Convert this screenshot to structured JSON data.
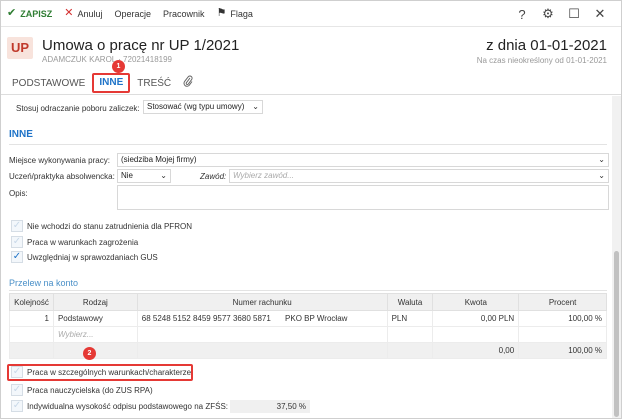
{
  "toolbar": {
    "save": "ZAPISZ",
    "cancel": "Anuluj",
    "operations": "Operacje",
    "employee": "Pracownik",
    "flag": "Flaga"
  },
  "window_controls": {
    "help": "?",
    "settings": "⚙",
    "maximize": "☐",
    "close": "✕"
  },
  "header": {
    "badge": "UP",
    "title": "Umowa o pracę nr UP 1/2021",
    "subtitle": "ADAMCZUK KAROL · 72021418199",
    "date": "z dnia 01-01-2021",
    "period": "Na czas nieokreślony od 01-01-2021"
  },
  "tabs": [
    "PODSTAWOWE",
    "INNE",
    "TREŚĆ"
  ],
  "markers": [
    "1",
    "2"
  ],
  "top_field": {
    "label": "Stosuj odraczanie poboru zaliczek:",
    "value": "Stosować (wg typu umowy)"
  },
  "section_inne": {
    "title": "INNE",
    "place_label": "Miejsce wykonywania pracy:",
    "place_value": "(siedziba Mojej firmy)",
    "graduate_label": "Uczeń/praktyka absolwencka:",
    "graduate_value": "Nie",
    "profession_label": "Zawód:",
    "profession_placeholder": "Wybierz zawód...",
    "desc_label": "Opis:"
  },
  "checkboxes_top": [
    {
      "label": "Nie wchodzi do stanu zatrudnienia dla PFRON",
      "checked": false
    },
    {
      "label": "Praca w warunkach zagrożenia",
      "checked": false
    },
    {
      "label": "Uwzględniaj w sprawozdaniach GUS",
      "checked": true
    }
  ],
  "transfer": {
    "title": "Przelew na konto",
    "columns": [
      "Kolejność",
      "Rodzaj",
      "Numer rachunku",
      "Waluta",
      "Kwota",
      "Procent"
    ],
    "rows": [
      {
        "order": "1",
        "type": "Podstawowy",
        "account": "68 5248 5152 8459 9577 3680 5871",
        "bank": "PKO BP Wrocław",
        "currency": "PLN",
        "amount": "0,00 PLN",
        "percent": "100,00 %"
      }
    ],
    "new_row_placeholder": "Wybierz...",
    "total_amount": "0,00",
    "total_percent": "100,00 %"
  },
  "checkboxes_bottom": [
    {
      "label": "Praca w szczególnych warunkach/charakterze",
      "checked": false
    },
    {
      "label": "Praca nauczycielska (do ZUS RPA)",
      "checked": false
    },
    {
      "label": "Indywidualna wysokość odpisu podstawowego na ZFŚS:",
      "checked": false
    }
  ],
  "zfss_value": "37,50 %",
  "colors": {
    "accent": "#1e73c8",
    "save_green": "#2e7d32",
    "marker_red": "#e53935"
  }
}
